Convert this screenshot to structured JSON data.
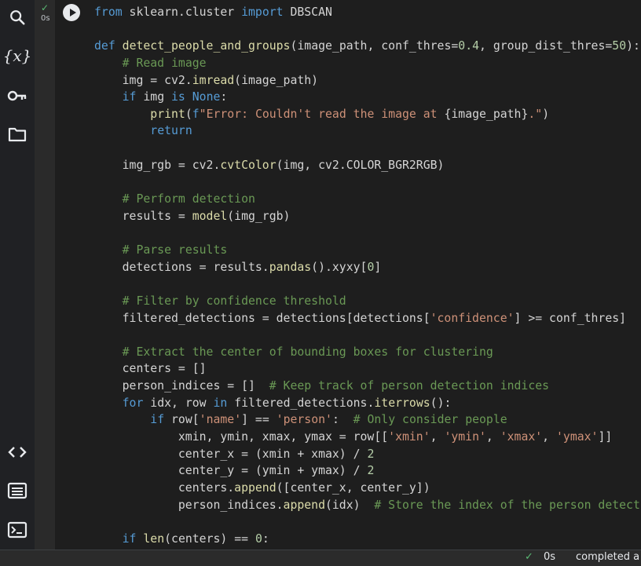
{
  "sidebar": {
    "icons": [
      "search-icon",
      "variables-icon",
      "secrets-key-icon",
      "files-folder-icon",
      "code-snippets-icon",
      "command-palette-icon",
      "terminal-icon"
    ],
    "variables_glyph": "{x}"
  },
  "cell": {
    "exec_check": "✓",
    "exec_time": "0s",
    "lines": [
      [
        [
          "kw",
          "from"
        ],
        [
          "id",
          " sklearn.cluster "
        ],
        [
          "kw",
          "import"
        ],
        [
          "id",
          " DBSCAN"
        ]
      ],
      [],
      [
        [
          "kw",
          "def"
        ],
        [
          "id",
          " "
        ],
        [
          "fn",
          "detect_people_and_groups"
        ],
        [
          "id",
          "(image_path, conf_thres="
        ],
        [
          "nm",
          "0.4"
        ],
        [
          "id",
          ", group_dist_thres="
        ],
        [
          "nm",
          "50"
        ],
        [
          "id",
          "):"
        ]
      ],
      [
        [
          "id",
          "    "
        ],
        [
          "cm",
          "# Read image"
        ]
      ],
      [
        [
          "id",
          "    img = cv2."
        ],
        [
          "fn",
          "imread"
        ],
        [
          "id",
          "(image_path)"
        ]
      ],
      [
        [
          "id",
          "    "
        ],
        [
          "kw",
          "if"
        ],
        [
          "id",
          " img "
        ],
        [
          "kw",
          "is"
        ],
        [
          "id",
          " "
        ],
        [
          "kw",
          "None"
        ],
        [
          "id",
          ":"
        ]
      ],
      [
        [
          "id",
          "        "
        ],
        [
          "fn",
          "print"
        ],
        [
          "id",
          "("
        ],
        [
          "kw",
          "f"
        ],
        [
          "st",
          "\"Error: Couldn't read the image at "
        ],
        [
          "id",
          "{image_path}"
        ],
        [
          "st",
          ".\""
        ],
        [
          "id",
          ")"
        ]
      ],
      [
        [
          "id",
          "        "
        ],
        [
          "kw",
          "return"
        ]
      ],
      [],
      [
        [
          "id",
          "    img_rgb = cv2."
        ],
        [
          "fn",
          "cvtColor"
        ],
        [
          "id",
          "(img, cv2.COLOR_BGR2RGB)"
        ]
      ],
      [],
      [
        [
          "id",
          "    "
        ],
        [
          "cm",
          "# Perform detection"
        ]
      ],
      [
        [
          "id",
          "    results = "
        ],
        [
          "fn",
          "model"
        ],
        [
          "id",
          "(img_rgb)"
        ]
      ],
      [],
      [
        [
          "id",
          "    "
        ],
        [
          "cm",
          "# Parse results"
        ]
      ],
      [
        [
          "id",
          "    detections = results."
        ],
        [
          "fn",
          "pandas"
        ],
        [
          "id",
          "().xyxy["
        ],
        [
          "nm",
          "0"
        ],
        [
          "id",
          "]"
        ]
      ],
      [],
      [
        [
          "id",
          "    "
        ],
        [
          "cm",
          "# Filter by confidence threshold"
        ]
      ],
      [
        [
          "id",
          "    filtered_detections = detections[detections["
        ],
        [
          "st",
          "'confidence'"
        ],
        [
          "id",
          "] >= conf_thres]"
        ]
      ],
      [],
      [
        [
          "id",
          "    "
        ],
        [
          "cm",
          "# Extract the center of bounding boxes for clustering"
        ]
      ],
      [
        [
          "id",
          "    centers = []"
        ]
      ],
      [
        [
          "id",
          "    person_indices = []  "
        ],
        [
          "cm",
          "# Keep track of person detection indices"
        ]
      ],
      [
        [
          "id",
          "    "
        ],
        [
          "kw",
          "for"
        ],
        [
          "id",
          " idx, row "
        ],
        [
          "kw",
          "in"
        ],
        [
          "id",
          " filtered_detections."
        ],
        [
          "fn",
          "iterrows"
        ],
        [
          "id",
          "():"
        ]
      ],
      [
        [
          "id",
          "        "
        ],
        [
          "kw",
          "if"
        ],
        [
          "id",
          " row["
        ],
        [
          "st",
          "'name'"
        ],
        [
          "id",
          "] == "
        ],
        [
          "st",
          "'person'"
        ],
        [
          "id",
          ":  "
        ],
        [
          "cm",
          "# Only consider people"
        ]
      ],
      [
        [
          "id",
          "            xmin, ymin, xmax, ymax = row[["
        ],
        [
          "st",
          "'xmin'"
        ],
        [
          "id",
          ", "
        ],
        [
          "st",
          "'ymin'"
        ],
        [
          "id",
          ", "
        ],
        [
          "st",
          "'xmax'"
        ],
        [
          "id",
          ", "
        ],
        [
          "st",
          "'ymax'"
        ],
        [
          "id",
          "]]"
        ]
      ],
      [
        [
          "id",
          "            center_x = (xmin + xmax) / "
        ],
        [
          "nm",
          "2"
        ]
      ],
      [
        [
          "id",
          "            center_y = (ymin + ymax) / "
        ],
        [
          "nm",
          "2"
        ]
      ],
      [
        [
          "id",
          "            centers."
        ],
        [
          "fn",
          "append"
        ],
        [
          "id",
          "([center_x, center_y])"
        ]
      ],
      [
        [
          "id",
          "            person_indices."
        ],
        [
          "fn",
          "append"
        ],
        [
          "id",
          "(idx)  "
        ],
        [
          "cm",
          "# Store the index of the person detectio"
        ]
      ],
      [],
      [
        [
          "id",
          "    "
        ],
        [
          "kw",
          "if"
        ],
        [
          "id",
          " "
        ],
        [
          "fn",
          "len"
        ],
        [
          "id",
          "(centers) == "
        ],
        [
          "nm",
          "0"
        ],
        [
          "id",
          ":"
        ]
      ]
    ]
  },
  "status": {
    "check": "✓",
    "time": "0s",
    "text": "completed a"
  },
  "colors": {
    "background": "#1e1e1e",
    "keyword": "#569cd6",
    "function": "#dcdcaa",
    "comment": "#6a9955",
    "string": "#ce9178",
    "number": "#b5cea8",
    "success": "#5bb974"
  }
}
